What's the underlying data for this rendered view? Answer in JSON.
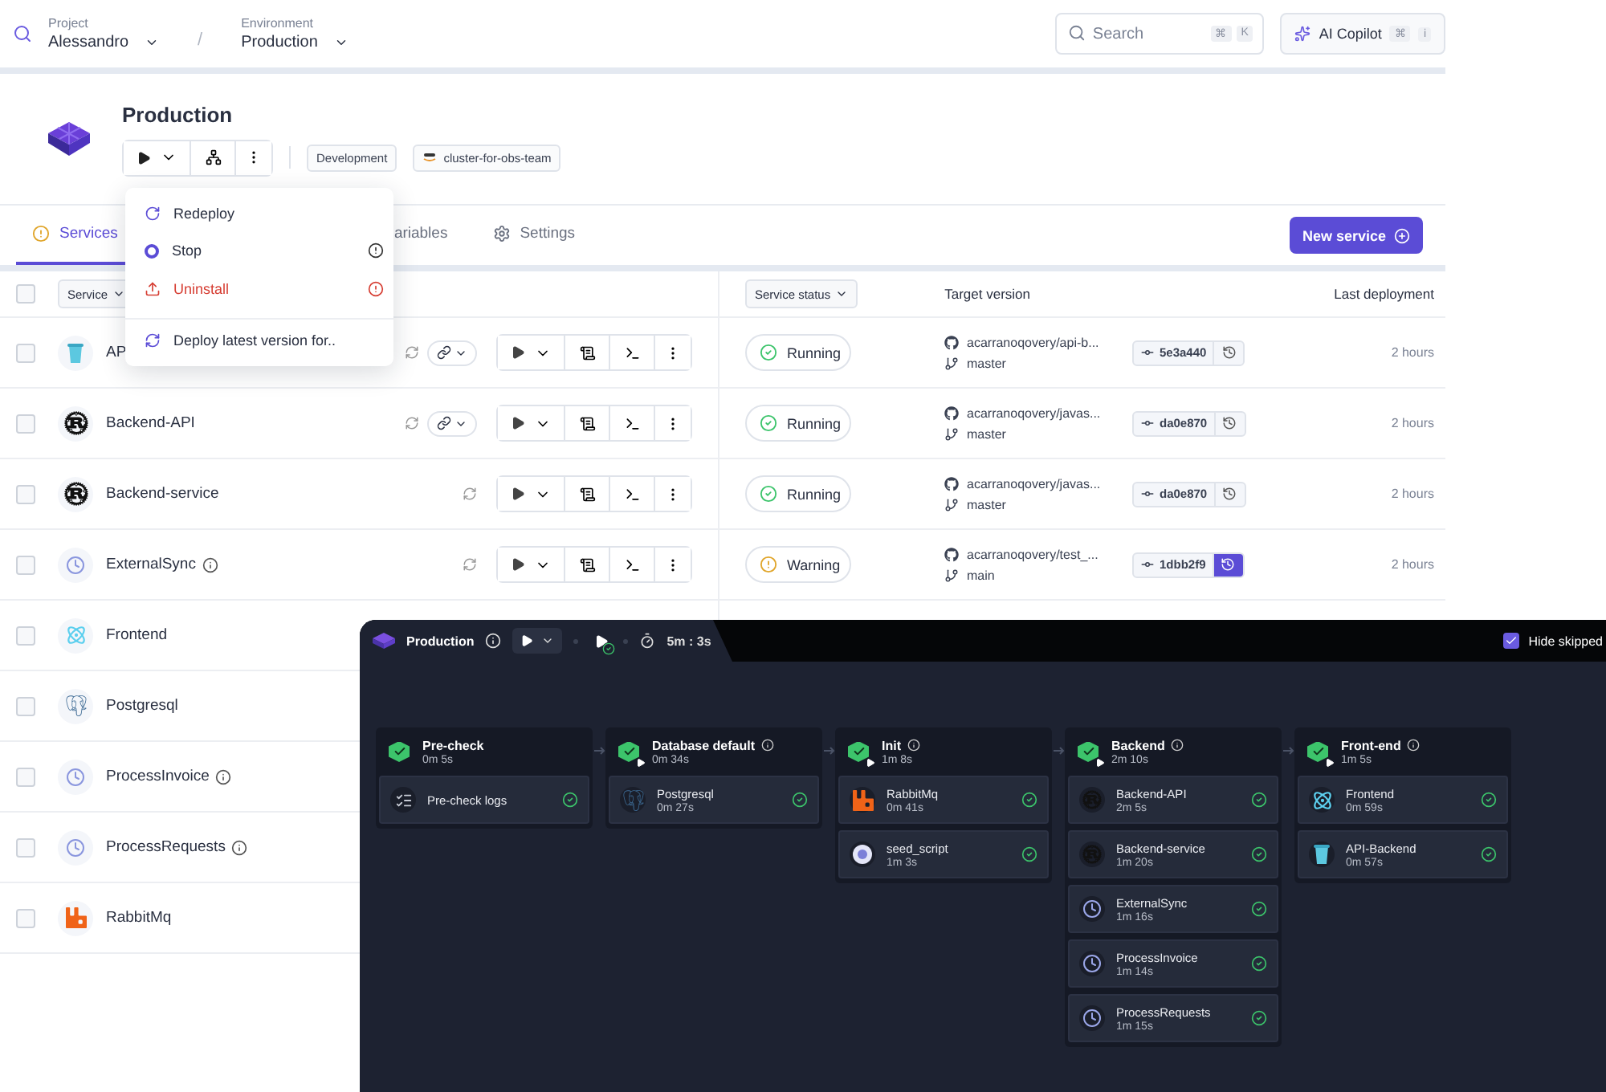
{
  "topbar": {
    "project_label": "Project",
    "project": "Alessandro",
    "separator": "/",
    "environment_label": "Environment",
    "environment": "Production",
    "search": {
      "placeholder": "Search",
      "keys": [
        "⌘",
        "K"
      ]
    },
    "copilot": {
      "label": "AI Copilot",
      "keys": [
        "⌘",
        "i"
      ]
    }
  },
  "environment": {
    "title": "Production",
    "tags": [
      {
        "label": "Development",
        "kind": "plain"
      },
      {
        "label": "cluster-for-obs-team",
        "kind": "aws"
      }
    ]
  },
  "tabs": [
    {
      "label": "Services",
      "selected": true,
      "kind": "alert"
    },
    {
      "label": "ariables",
      "selected": false,
      "kind": "plain"
    },
    {
      "label": "Settings",
      "selected": false,
      "kind": "gear"
    }
  ],
  "new_service_button": "New service",
  "table": {
    "select_all_checked": false,
    "service_filter": "Service",
    "status_filter": "Service status",
    "columns": [
      "Target version",
      "Last deployment"
    ],
    "rows": [
      {
        "name": "AP",
        "kind": "bucket",
        "checked": false,
        "info": false,
        "sync": true,
        "link": true,
        "status": {
          "kind": "running",
          "label": "Running"
        },
        "repo": "acarranoqovery/api-b...",
        "branch": "master",
        "commit": "5e3a440",
        "rollback_active": false,
        "last": "2 hours"
      },
      {
        "name": "Backend-API",
        "kind": "rust",
        "checked": false,
        "info": false,
        "sync": true,
        "link": true,
        "status": {
          "kind": "running",
          "label": "Running"
        },
        "repo": "acarranoqovery/javas...",
        "branch": "master",
        "commit": "da0e870",
        "rollback_active": false,
        "last": "2 hours"
      },
      {
        "name": "Backend-service",
        "kind": "rust",
        "checked": false,
        "info": false,
        "sync": true,
        "link": false,
        "status": {
          "kind": "running",
          "label": "Running"
        },
        "repo": "acarranoqovery/javas...",
        "branch": "master",
        "commit": "da0e870",
        "rollback_active": false,
        "last": "2 hours"
      },
      {
        "name": "ExternalSync",
        "kind": "clock",
        "checked": false,
        "info": true,
        "sync": true,
        "link": false,
        "status": {
          "kind": "warning",
          "label": "Warning"
        },
        "repo": "acarranoqovery/test_...",
        "branch": "main",
        "commit": "1dbb2f9",
        "rollback_active": true,
        "last": "2 hours"
      },
      {
        "name": "Frontend",
        "kind": "react",
        "checked": false,
        "info": false
      },
      {
        "name": "Postgresql",
        "kind": "postgres",
        "checked": false,
        "info": false
      },
      {
        "name": "ProcessInvoice",
        "kind": "clock",
        "checked": false,
        "info": true
      },
      {
        "name": "ProcessRequests",
        "kind": "clock",
        "checked": false,
        "info": true
      },
      {
        "name": "RabbitMq",
        "kind": "rabbit",
        "checked": false,
        "info": false
      }
    ]
  },
  "deploy_menu": [
    {
      "label": "Redeploy",
      "kind": "redeploy",
      "danger": false,
      "info": false,
      "separated": false
    },
    {
      "label": "Stop",
      "kind": "stop",
      "danger": false,
      "info": true,
      "separated": false
    },
    {
      "label": "Uninstall",
      "kind": "uninstall",
      "danger": true,
      "info": true,
      "separated": false
    },
    {
      "label": "Deploy latest version for..",
      "kind": "refresh",
      "danger": false,
      "info": false,
      "separated": true
    }
  ],
  "pipeline": {
    "title": "Production",
    "duration": "5m : 3s",
    "hide_skipped": {
      "label": "Hide skipped",
      "checked": true
    },
    "stages": [
      {
        "name": "Pre-check",
        "duration": "0m 5s",
        "info": false,
        "play_badge": false,
        "services": [
          {
            "name": "Pre-check logs",
            "kind": "list"
          }
        ]
      },
      {
        "name": "Database default",
        "duration": "0m 34s",
        "info": true,
        "play_badge": true,
        "services": [
          {
            "name": "Postgresql",
            "duration": "0m 27s",
            "kind": "postgres"
          }
        ]
      },
      {
        "name": "Init",
        "duration": "1m 8s",
        "info": true,
        "play_badge": true,
        "services": [
          {
            "name": "RabbitMq",
            "duration": "0m 41s",
            "kind": "rabbit"
          },
          {
            "name": "seed_script",
            "duration": "1m 3s",
            "kind": "seed"
          }
        ]
      },
      {
        "name": "Backend",
        "duration": "2m 10s",
        "info": true,
        "play_badge": true,
        "services": [
          {
            "name": "Backend-API",
            "duration": "2m 5s",
            "kind": "rust"
          },
          {
            "name": "Backend-service",
            "duration": "1m 20s",
            "kind": "rust"
          },
          {
            "name": "ExternalSync",
            "duration": "1m 16s",
            "kind": "clock"
          },
          {
            "name": "ProcessInvoice",
            "duration": "1m 14s",
            "kind": "clock"
          },
          {
            "name": "ProcessRequests",
            "duration": "1m 15s",
            "kind": "clock"
          }
        ]
      },
      {
        "name": "Front-end",
        "duration": "1m 5s",
        "info": true,
        "play_badge": true,
        "services": [
          {
            "name": "Frontend",
            "duration": "0m 59s",
            "kind": "react"
          },
          {
            "name": "API-Backend",
            "duration": "0m 57s",
            "kind": "bucket"
          }
        ]
      }
    ]
  }
}
